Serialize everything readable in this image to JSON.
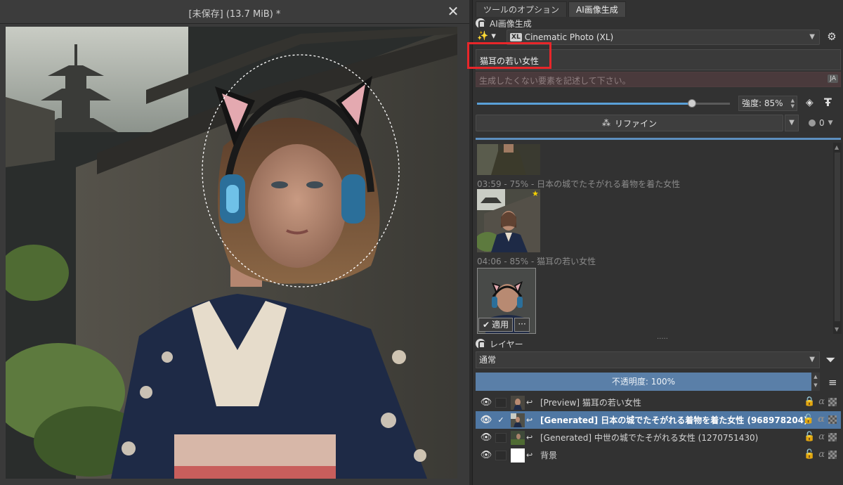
{
  "canvas": {
    "title": "[未保存]  (13.7 MiB) *",
    "close_glyph": "✕"
  },
  "docker": {
    "tabs": [
      {
        "label": "ツールのオプション",
        "active": false
      },
      {
        "label": "AI画像生成",
        "active": true
      }
    ],
    "ai_header": "AI画像生成",
    "model": {
      "badge": "XL",
      "name": "Cinematic Photo (XL)"
    },
    "prompt": "猫耳の若い女性",
    "negative_placeholder": "生成したくない要素を記述して下さい。",
    "language_badge": "JA",
    "strength": {
      "label": "強度: 85%",
      "value": 0.85
    },
    "refine_label": "リファイン",
    "queue_count": "0",
    "history": [
      {
        "caption": "03:59 - 75% - 日本の城でたそがれる着物を着た女性"
      },
      {
        "caption": "04:06 - 85% - 猫耳の若い女性"
      }
    ],
    "apply_label": "適用",
    "more_label": "···",
    "grip": ".....",
    "layers_header": "レイヤー",
    "blend_mode": "通常",
    "opacity_label": "不透明度: 100%",
    "layers": [
      {
        "name": "[Preview] 猫耳の若い女性",
        "selected": false,
        "checked": false,
        "thumb": "preview"
      },
      {
        "name": "[Generated] 日本の城でたそがれる着物を着た女性 (968978204)",
        "selected": true,
        "checked": true,
        "thumb": "kimono"
      },
      {
        "name": "[Generated] 中世の城でたそがれる女性 (1270751430)",
        "selected": false,
        "checked": false,
        "thumb": "medieval"
      },
      {
        "name": "背景",
        "selected": false,
        "checked": false,
        "thumb": "white"
      }
    ],
    "colors": {
      "accent": "#5a7fa8",
      "highlight_box": "#e8262a",
      "star": "#f5d000"
    }
  }
}
